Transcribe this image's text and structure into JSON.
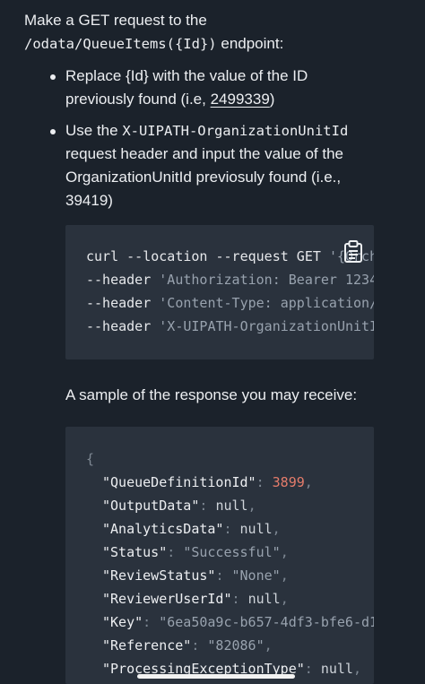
{
  "intro": {
    "line1": "Make a GET request to the",
    "endpoint": "/odata/QueueItems({Id})",
    "line2_suffix": " endpoint:"
  },
  "bullets": [
    {
      "line1": "Replace {Id} with the value of the ID",
      "line2_prefix": "previously found (i.e, ",
      "line2_link": "2499339",
      "line2_suffix": ")"
    },
    {
      "line1_prefix": "Use the ",
      "line1_code": "X-UIPATH-OrganizationUnitId",
      "line2": "request header and input the value of the",
      "line3": "OrganizationUnitId previosuly found (i.e.,",
      "line4": "39419)"
    }
  ],
  "request_code": {
    "lines": [
      {
        "cmd": "curl --location --request GET ",
        "str": "'{Orch"
      },
      {
        "cmd": "--header ",
        "str": "'Authorization: Bearer 1234"
      },
      {
        "cmd": "--header ",
        "str": "'Content-Type: application/"
      },
      {
        "cmd": "--header ",
        "str": "'X-UIPATH-OrganizationUnitI"
      }
    ],
    "copy_icon": "clipboard-icon"
  },
  "sample_label": "A sample of the response you may receive:",
  "response_code": {
    "open_brace": "{",
    "fields": [
      {
        "key": "\"QueueDefinitionId\"",
        "value": "3899",
        "kind": "num",
        "comma": ","
      },
      {
        "key": "\"OutputData\"",
        "value": "null",
        "kind": "null",
        "comma": ","
      },
      {
        "key": "\"AnalyticsData\"",
        "value": "null",
        "kind": "null",
        "comma": ","
      },
      {
        "key": "\"Status\"",
        "value": "\"Successful\"",
        "kind": "str",
        "comma": ","
      },
      {
        "key": "\"ReviewStatus\"",
        "value": "\"None\"",
        "kind": "str",
        "comma": ","
      },
      {
        "key": "\"ReviewerUserId\"",
        "value": "null",
        "kind": "null",
        "comma": ","
      },
      {
        "key": "\"Key\"",
        "value": "\"6ea50a9c-b657-4df3-bfe6-d1",
        "kind": "str",
        "comma": ""
      },
      {
        "key": "\"Reference\"",
        "value": "\"82086\"",
        "kind": "str",
        "comma": ","
      },
      {
        "key": "\"ProcessingExceptionType\"",
        "value": "null",
        "kind": "null",
        "comma": ","
      }
    ]
  },
  "colors": {
    "background": "#1b222b",
    "code_background": "#2a323d",
    "number": "#e57c6b",
    "string": "#98a2ae"
  }
}
